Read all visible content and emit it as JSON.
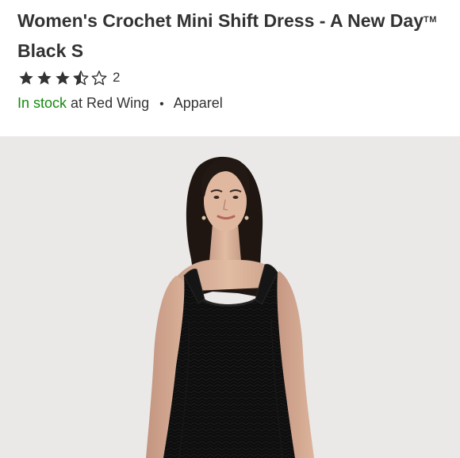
{
  "product": {
    "title_main": "Women's Crochet Mini Shift Dress - A New Day",
    "title_tm": "TM",
    "title_tail": " Black S",
    "rating": {
      "value": 3.5,
      "max": 5,
      "count": "2"
    },
    "availability": {
      "status": "In stock",
      "store_text": "at Red Wing",
      "separator": "•",
      "category": "Apparel"
    },
    "image": {
      "alt": "Model wearing black crochet mini shift dress"
    }
  },
  "colors": {
    "in_stock": "#138a0e",
    "text": "#333333",
    "image_bg": "#eae9e7",
    "star": "#333333"
  },
  "icons": [
    "star-filled-icon",
    "star-half-icon",
    "star-outline-icon"
  ]
}
